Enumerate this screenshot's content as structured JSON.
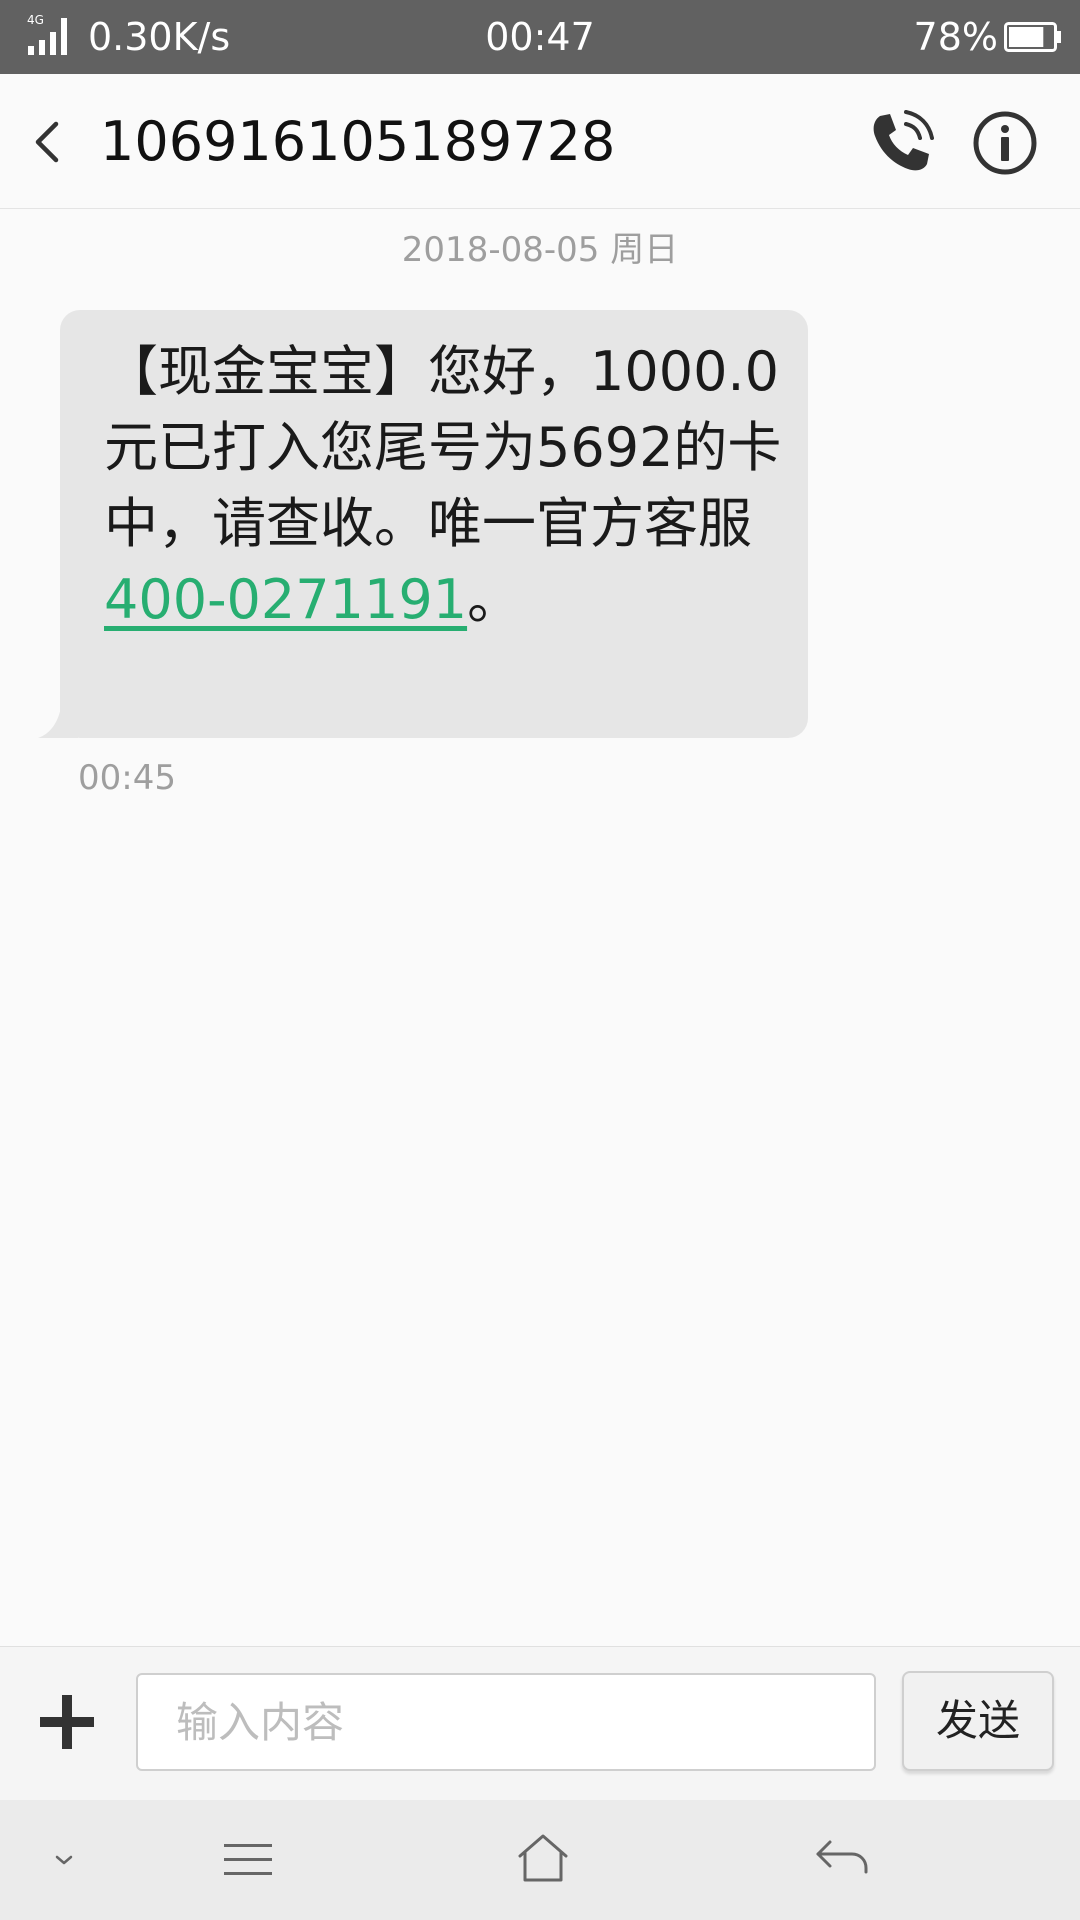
{
  "status_bar": {
    "network_type": "4G",
    "speed": "0.30K/s",
    "time": "00:47",
    "battery": "78%",
    "battery_level": 0.78
  },
  "header": {
    "contact": "106916105189728"
  },
  "conversation": {
    "date_separator": "2018-08-05 周日",
    "messages": [
      {
        "text_before": "【现金宝宝】您好，1000.0元已打入您尾号为5692的卡中，请查收。唯一官方客服",
        "phone_link": "400-0271191",
        "text_after": "。",
        "time": "00:45"
      }
    ]
  },
  "composer": {
    "placeholder": "输入内容",
    "value": "",
    "send_label": "发送"
  },
  "colors": {
    "status_bar": "#616161",
    "bubble": "#e6e6e6",
    "link": "#27ae71"
  }
}
